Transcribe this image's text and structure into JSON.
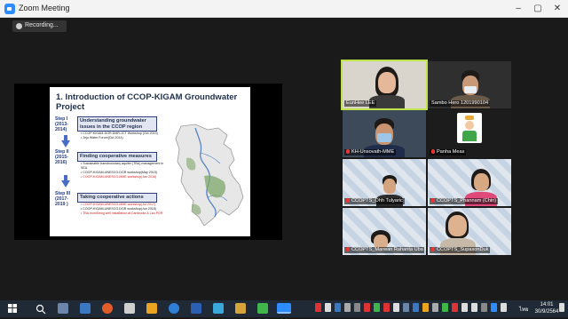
{
  "window": {
    "title": "Zoom Meeting"
  },
  "recording": {
    "label": "Recording..."
  },
  "slide": {
    "title": "1. Introduction of CCOP-KIGAM Groundwater Project",
    "steps": [
      {
        "label": "Step I\n(2013-\n2014)",
        "heading": "Understanding groundwater issues in the CCOP region",
        "bullets": [
          {
            "text": "CCOP-KIGAM-DGR-DMR-JCT Workshop (Oct 2013)",
            "red": false
          },
          {
            "text": "Jeju Water Forum(Oct 2014)",
            "red": false
          }
        ]
      },
      {
        "label": "Step II\n(2015-\n2016)",
        "heading": "Finding cooperative measures",
        "bullets": [
          {
            "text": "Sustainable transboundary aquifer (TBA) management in SEA",
            "red": false
          },
          {
            "text": "COOP-KIGAM-UNESCO-DGR workshop(May 2015)",
            "red": false
          },
          {
            "text": "COOP-KIGAM-UNESCO-MME workshop(Jan 2016)",
            "red": true
          }
        ]
      },
      {
        "label": "Step III\n(2017-\n2019 )",
        "heading": "Taking cooperative actions",
        "bullets": [
          {
            "text": "COOP-KIGAM-UNESCO-MME workshop(Jul 2017)",
            "red": true
          },
          {
            "text": "COOP-KIGAM-UNESCO-DGR workshop(Jun 2018)",
            "red": false
          },
          {
            "text": "TBA monitoring well installation at Cambodia & Lao PDR",
            "red": true
          }
        ]
      }
    ]
  },
  "participants": [
    {
      "name": "EunHee LEE",
      "muted": false,
      "active": true
    },
    {
      "name": "Sambo Hero 1201990104",
      "muted": false,
      "active": false
    },
    {
      "name": "KH-Unsovath-MME",
      "muted": true,
      "active": false
    },
    {
      "name": "Panha Meas",
      "muted": true,
      "active": false
    },
    {
      "name": "CCOPTS_Ohh Tulyaric",
      "muted": true,
      "active": false
    },
    {
      "name": "CCOPTS_Phannam (Chin)",
      "muted": true,
      "active": false
    },
    {
      "name": "CCOPTS_Marwan Rahanta Uba",
      "muted": true,
      "active": false
    },
    {
      "name": "CCOPTS_SupasonDuk",
      "muted": true,
      "active": false
    }
  ],
  "taskbar": {
    "lang": "ไทย",
    "time": "14:01",
    "date": "30/9/2564"
  },
  "colors": {
    "accent": "#2d8cff",
    "active_speaker": "#bfe34a",
    "taskbar": "#1f2a36"
  }
}
